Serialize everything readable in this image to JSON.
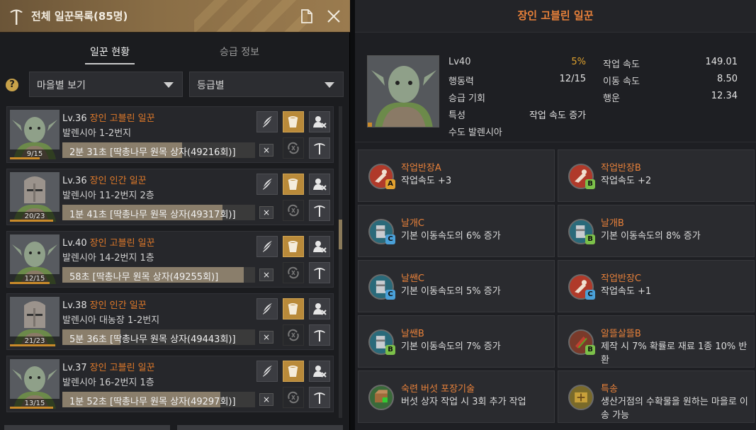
{
  "left_panel": {
    "title": "전체 일꾼목록(85명)",
    "tabs": [
      "일꾼 현황",
      "승급 정보"
    ],
    "help": "?",
    "filter_village": "마을별 보기",
    "filter_grade": "등급별",
    "workers": [
      {
        "level": "Lv.36",
        "name": "장인 고블린 일꾼",
        "location": "발렌시아 1-2번지",
        "stamina": "9/15",
        "stamina_fraction": 0.6,
        "task": "2분 31초 [딱총나무 원목 상자(49216회)]",
        "progress": 0.62,
        "type": "goblin"
      },
      {
        "level": "Lv.36",
        "name": "장인 인간 일꾼",
        "location": "발렌시아 11-2번지 2층",
        "stamina": "20/23",
        "stamina_fraction": 0.87,
        "task": "1분 41초 [딱총나무 원목 상자(49317회)]",
        "progress": 0.83,
        "type": "human"
      },
      {
        "level": "Lv.40",
        "name": "장인 고블린 일꾼",
        "location": "발렌시아 14-2번지 1층",
        "stamina": "12/15",
        "stamina_fraction": 0.8,
        "task": "58초 [딱총나무 원목 상자(49255회)]",
        "progress": 0.94,
        "type": "goblin"
      },
      {
        "level": "Lv.38",
        "name": "장인 인간 일꾼",
        "location": "발렌시아 대농장 1-2번지",
        "stamina": "21/23",
        "stamina_fraction": 0.91,
        "task": "5분 36초 [딱총나무 원목 상자(49443회)]",
        "progress": 0.3,
        "type": "human"
      },
      {
        "level": "Lv.37",
        "name": "장인 고블린 일꾼",
        "location": "발렌시아 16-2번지 1층",
        "stamina": "13/15",
        "stamina_fraction": 0.87,
        "task": "1분 52초 [딱총나무 원목 상자(49297회)]",
        "progress": 0.82,
        "type": "goblin"
      }
    ],
    "cancel_label": "×"
  },
  "right_panel": {
    "title": "장인 고블린 일꾼",
    "stats": {
      "level": "Lv40",
      "exp": "5%",
      "action_label": "행동력",
      "action_value": "12/15",
      "promo_label": "승급 기회",
      "trait_label": "특성",
      "trait_value": "작업 속도 증가",
      "home": "수도 발렌시아",
      "work_speed_label": "작업 속도",
      "work_speed": "149.01",
      "move_speed_label": "이동 속도",
      "move_speed": "8.50",
      "luck_label": "행운",
      "luck": "12.34"
    },
    "skills": [
      {
        "name": "작업반장A",
        "desc": "작업속도 +3",
        "badge": "A",
        "icon": "pointing-hand-icon",
        "color": "#b03a2a"
      },
      {
        "name": "작업반장B",
        "desc": "작업속도 +2",
        "badge": "B",
        "icon": "pointing-hand-icon",
        "color": "#b03a2a"
      },
      {
        "name": "날개C",
        "desc": "기본 이동속도의 6% 증가",
        "badge": "C",
        "icon": "boot-icon",
        "color": "#2a6a7a"
      },
      {
        "name": "날개B",
        "desc": "기본 이동속도의 8% 증가",
        "badge": "B",
        "icon": "boot-icon",
        "color": "#2a6a7a"
      },
      {
        "name": "날쌘C",
        "desc": "기본 이동속도의 5% 증가",
        "badge": "C",
        "icon": "boot-icon",
        "color": "#2a6a7a"
      },
      {
        "name": "작업반장C",
        "desc": "작업속도 +1",
        "badge": "C",
        "icon": "pointing-hand-icon",
        "color": "#b03a2a"
      },
      {
        "name": "날쌘B",
        "desc": "기본 이동속도의 7% 증가",
        "badge": "B",
        "icon": "boot-icon",
        "color": "#2a6a7a"
      },
      {
        "name": "알뜰살뜰B",
        "desc": "제작 시 7% 확률로 재료 1종 10% 반환",
        "badge": "B",
        "icon": "tools-icon",
        "color": "#7a3a2a"
      },
      {
        "name": "숙련 버섯 포장기술",
        "desc": "버섯 상자 작업 시 3회 추가 작업",
        "badge": "",
        "icon": "crate-icon",
        "color": "#3a6a3a"
      },
      {
        "name": "특송",
        "desc": "생산거점의 수확물을 원하는 마을로 이송 가능",
        "badge": "",
        "icon": "delivery-icon",
        "color": "#7a6a2a"
      }
    ]
  }
}
